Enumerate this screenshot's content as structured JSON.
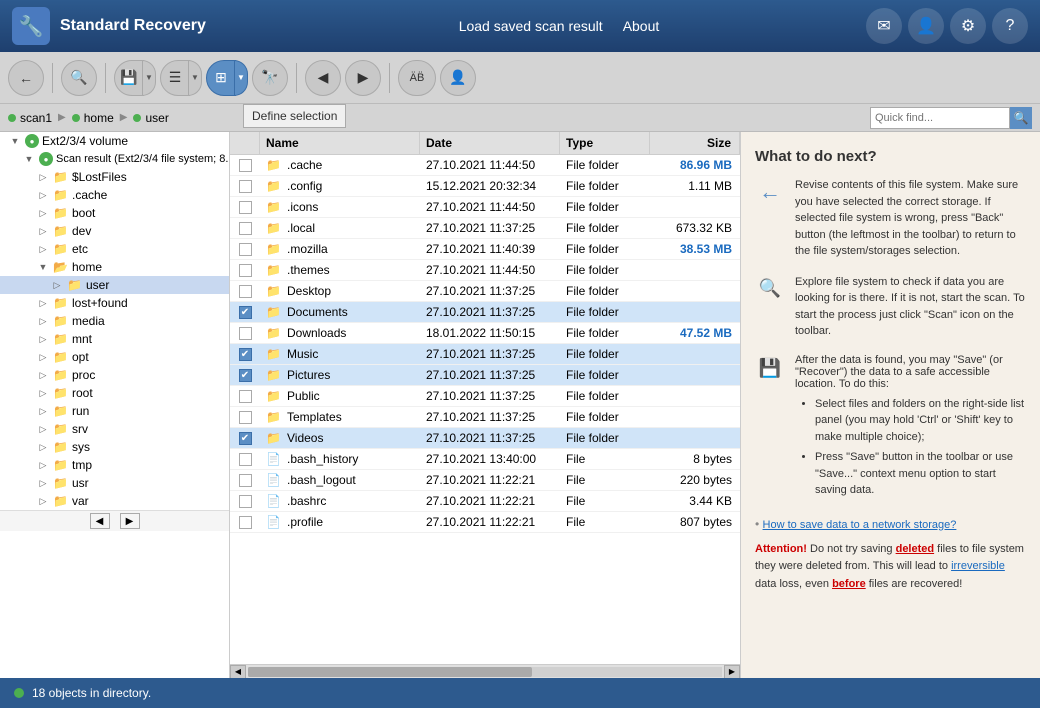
{
  "header": {
    "title": "Standard Recovery",
    "logo_char": "🔧",
    "nav": {
      "load_scan": "Load saved scan result",
      "about": "About"
    },
    "icon_btns": [
      "✉",
      "👤",
      "⚙",
      "?"
    ]
  },
  "toolbar": {
    "define_selection_popup": "Define selection",
    "buttons": [
      {
        "id": "back",
        "icon": "←",
        "active": false
      },
      {
        "id": "scan",
        "icon": "🔍",
        "active": false
      },
      {
        "id": "save",
        "icon": "💾",
        "active": false
      },
      {
        "id": "list",
        "icon": "☰",
        "active": false
      },
      {
        "id": "view",
        "icon": "⊞",
        "active": true
      },
      {
        "id": "binoculars",
        "icon": "🔭",
        "active": false
      },
      {
        "id": "prev",
        "icon": "◀",
        "active": false
      },
      {
        "id": "next",
        "icon": "▶",
        "active": false
      },
      {
        "id": "ab",
        "icon": "AB̈",
        "active": false
      },
      {
        "id": "person",
        "icon": "👤",
        "active": false
      }
    ]
  },
  "breadcrumb": {
    "items": [
      "scan1",
      "home",
      "user"
    ],
    "search_placeholder": "Quick find..."
  },
  "tree": {
    "items": [
      {
        "id": "ext234",
        "label": "Ext2/3/4 volume",
        "indent": 0,
        "type": "volume",
        "expanded": true,
        "has_status": true
      },
      {
        "id": "scan_result",
        "label": "Scan result (Ext2/3/4 file system; 8.…",
        "indent": 1,
        "type": "scan",
        "expanded": true,
        "has_status": true
      },
      {
        "id": "lostfiles",
        "label": "$LostFiles",
        "indent": 2,
        "type": "folder"
      },
      {
        "id": "cache",
        "label": ".cache",
        "indent": 2,
        "type": "folder"
      },
      {
        "id": "boot",
        "label": "boot",
        "indent": 2,
        "type": "folder"
      },
      {
        "id": "dev",
        "label": "dev",
        "indent": 2,
        "type": "folder"
      },
      {
        "id": "etc",
        "label": "etc",
        "indent": 2,
        "type": "folder"
      },
      {
        "id": "home",
        "label": "home",
        "indent": 2,
        "type": "folder",
        "expanded": true
      },
      {
        "id": "user",
        "label": "user",
        "indent": 3,
        "type": "folder",
        "selected": true
      },
      {
        "id": "lostfound",
        "label": "lost+found",
        "indent": 2,
        "type": "folder"
      },
      {
        "id": "media",
        "label": "media",
        "indent": 2,
        "type": "folder"
      },
      {
        "id": "mnt",
        "label": "mnt",
        "indent": 2,
        "type": "folder"
      },
      {
        "id": "opt",
        "label": "opt",
        "indent": 2,
        "type": "folder"
      },
      {
        "id": "proc",
        "label": "proc",
        "indent": 2,
        "type": "folder"
      },
      {
        "id": "root",
        "label": "root",
        "indent": 2,
        "type": "folder"
      },
      {
        "id": "run",
        "label": "run",
        "indent": 2,
        "type": "folder"
      },
      {
        "id": "srv",
        "label": "srv",
        "indent": 2,
        "type": "folder"
      },
      {
        "id": "sys",
        "label": "sys",
        "indent": 2,
        "type": "folder"
      },
      {
        "id": "tmp",
        "label": "tmp",
        "indent": 2,
        "type": "folder"
      },
      {
        "id": "usr",
        "label": "usr",
        "indent": 2,
        "type": "folder"
      },
      {
        "id": "var",
        "label": "var",
        "indent": 2,
        "type": "folder"
      }
    ]
  },
  "file_list": {
    "columns": [
      "",
      "Name",
      "Date",
      "Type",
      "Size"
    ],
    "rows": [
      {
        "checked": false,
        "name": ".cache",
        "date": "27.10.2021 11:44:50",
        "type": "File folder",
        "size": "86.96 MB",
        "size_blue": true,
        "is_folder": true
      },
      {
        "checked": false,
        "name": ".config",
        "date": "15.12.2021 20:32:34",
        "type": "File folder",
        "size": "1.11 MB",
        "size_blue": false,
        "is_folder": true
      },
      {
        "checked": false,
        "name": ".icons",
        "date": "27.10.2021 11:44:50",
        "type": "File folder",
        "size": "",
        "size_blue": false,
        "is_folder": true
      },
      {
        "checked": false,
        "name": ".local",
        "date": "27.10.2021 11:37:25",
        "type": "File folder",
        "size": "673.32 KB",
        "size_blue": false,
        "is_folder": true
      },
      {
        "checked": false,
        "name": ".mozilla",
        "date": "27.10.2021 11:40:39",
        "type": "File folder",
        "size": "38.53 MB",
        "size_blue": true,
        "is_folder": true
      },
      {
        "checked": false,
        "name": ".themes",
        "date": "27.10.2021 11:44:50",
        "type": "File folder",
        "size": "",
        "size_blue": false,
        "is_folder": true
      },
      {
        "checked": false,
        "name": "Desktop",
        "date": "27.10.2021 11:37:25",
        "type": "File folder",
        "size": "",
        "size_blue": false,
        "is_folder": true
      },
      {
        "checked": true,
        "name": "Documents",
        "date": "27.10.2021 11:37:25",
        "type": "File folder",
        "size": "",
        "size_blue": false,
        "is_folder": true
      },
      {
        "checked": false,
        "name": "Downloads",
        "date": "18.01.2022 11:50:15",
        "type": "File folder",
        "size": "47.52 MB",
        "size_blue": true,
        "is_folder": true
      },
      {
        "checked": true,
        "name": "Music",
        "date": "27.10.2021 11:37:25",
        "type": "File folder",
        "size": "",
        "size_blue": false,
        "is_folder": true
      },
      {
        "checked": true,
        "name": "Pictures",
        "date": "27.10.2021 11:37:25",
        "type": "File folder",
        "size": "",
        "size_blue": false,
        "is_folder": true
      },
      {
        "checked": false,
        "name": "Public",
        "date": "27.10.2021 11:37:25",
        "type": "File folder",
        "size": "",
        "size_blue": false,
        "is_folder": true
      },
      {
        "checked": false,
        "name": "Templates",
        "date": "27.10.2021 11:37:25",
        "type": "File folder",
        "size": "",
        "size_blue": false,
        "is_folder": true
      },
      {
        "checked": true,
        "name": "Videos",
        "date": "27.10.2021 11:37:25",
        "type": "File folder",
        "size": "",
        "size_blue": false,
        "is_folder": true
      },
      {
        "checked": false,
        "name": ".bash_history",
        "date": "27.10.2021 13:40:00",
        "type": "File",
        "size": "8 bytes",
        "size_blue": false,
        "is_folder": false
      },
      {
        "checked": false,
        "name": ".bash_logout",
        "date": "27.10.2021 11:22:21",
        "type": "File",
        "size": "220 bytes",
        "size_blue": false,
        "is_folder": false
      },
      {
        "checked": false,
        "name": ".bashrc",
        "date": "27.10.2021 11:22:21",
        "type": "File",
        "size": "3.44 KB",
        "size_blue": false,
        "is_folder": false
      },
      {
        "checked": false,
        "name": ".profile",
        "date": "27.10.2021 11:22:21",
        "type": "File",
        "size": "807 bytes",
        "size_blue": false,
        "is_folder": false
      }
    ]
  },
  "right_panel": {
    "title": "What to do next?",
    "tip1": "Revise contents of this file system. Make sure you have selected the correct storage. If selected file system is wrong, press \"Back\" button (the leftmost in the toolbar) to return to the file system/storages selection.",
    "tip2": "Explore file system to check if data you are looking for is there. If it is not, start the scan. To start the process just click \"Scan\" icon on the toolbar.",
    "tip3_intro": "After the data is found, you may \"Save\" (or \"Recover\") the data to a safe accessible location. To do this:",
    "tip3_bullets": [
      "Select files and folders on the right-side list panel (you may hold 'Ctrl' or 'Shift' key to make multiple choice);",
      "Press \"Save\" button in the toolbar or use \"Save...\" context menu option to start saving data."
    ],
    "network_link": "How to save data to a network storage?",
    "attention_prefix": "Attention!",
    "attention_body": " Do not try saving ",
    "attention_deleted": "deleted",
    "attention_mid": " files to file system they were deleted from. This will lead to ",
    "attention_irreversible": "irreversible",
    "attention_end": " data loss, even ",
    "attention_before": "before",
    "attention_final": " files are recovered!"
  },
  "status_bar": {
    "text": "18 objects in directory."
  }
}
